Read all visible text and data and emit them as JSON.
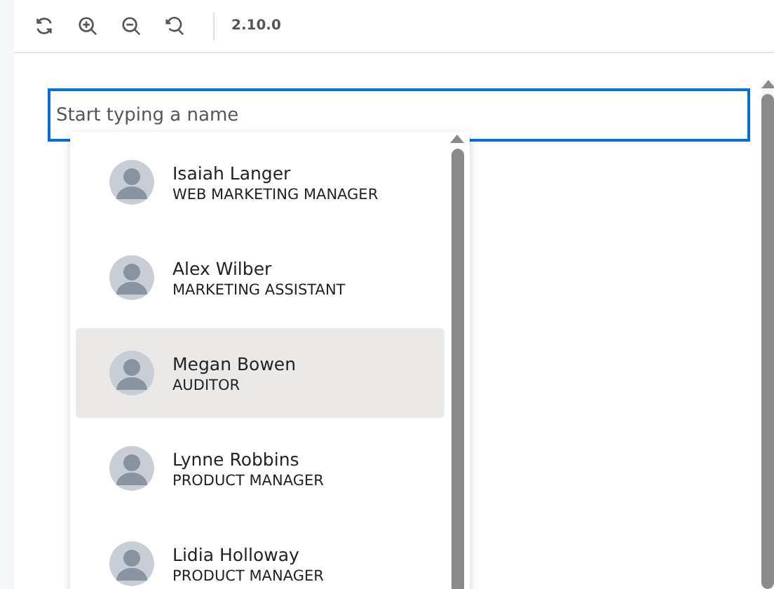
{
  "toolbar": {
    "version": "2.10.0"
  },
  "search": {
    "placeholder": "Start typing a name",
    "focused": true
  },
  "suggestions": [
    {
      "name": "Isaiah Langer",
      "title": "WEB MARKETING MANAGER",
      "selected": false
    },
    {
      "name": "Alex Wilber",
      "title": "MARKETING ASSISTANT",
      "selected": false
    },
    {
      "name": "Megan Bowen",
      "title": "AUDITOR",
      "selected": true
    },
    {
      "name": "Lynne Robbins",
      "title": "PRODUCT MANAGER",
      "selected": false
    },
    {
      "name": "Lidia Holloway",
      "title": "PRODUCT MANAGER",
      "selected": false
    }
  ]
}
